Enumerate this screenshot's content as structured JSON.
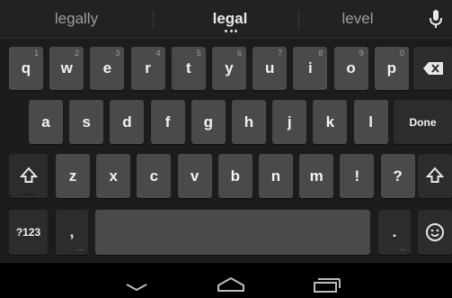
{
  "suggestions": {
    "left": "legally",
    "center": "legal",
    "right": "level"
  },
  "icons": {
    "mic": "microphone-icon",
    "backspace": "backspace-icon",
    "shift": "shift-icon",
    "emoji": "smiley-icon",
    "nav_back": "chevron-down-icon",
    "nav_home": "home-icon",
    "nav_recents": "recent-apps-icon"
  },
  "rows": {
    "row1": [
      {
        "label": "q",
        "hint": "1"
      },
      {
        "label": "w",
        "hint": "2"
      },
      {
        "label": "e",
        "hint": "3"
      },
      {
        "label": "r",
        "hint": "4"
      },
      {
        "label": "t",
        "hint": "5"
      },
      {
        "label": "y",
        "hint": "6"
      },
      {
        "label": "u",
        "hint": "7"
      },
      {
        "label": "i",
        "hint": "8"
      },
      {
        "label": "o",
        "hint": "9"
      },
      {
        "label": "p",
        "hint": "0"
      }
    ],
    "row2": [
      "a",
      "s",
      "d",
      "f",
      "g",
      "h",
      "j",
      "k",
      "l"
    ],
    "row3": [
      "z",
      "x",
      "c",
      "v",
      "b",
      "n",
      "m",
      "!",
      "?"
    ]
  },
  "keys": {
    "done": "Done",
    "symbols": "?123",
    "comma": ",",
    "period": "."
  },
  "colors": {
    "key": "#4a4a4a",
    "function_key": "#2c2c2c",
    "background": "#1c1c1c"
  }
}
